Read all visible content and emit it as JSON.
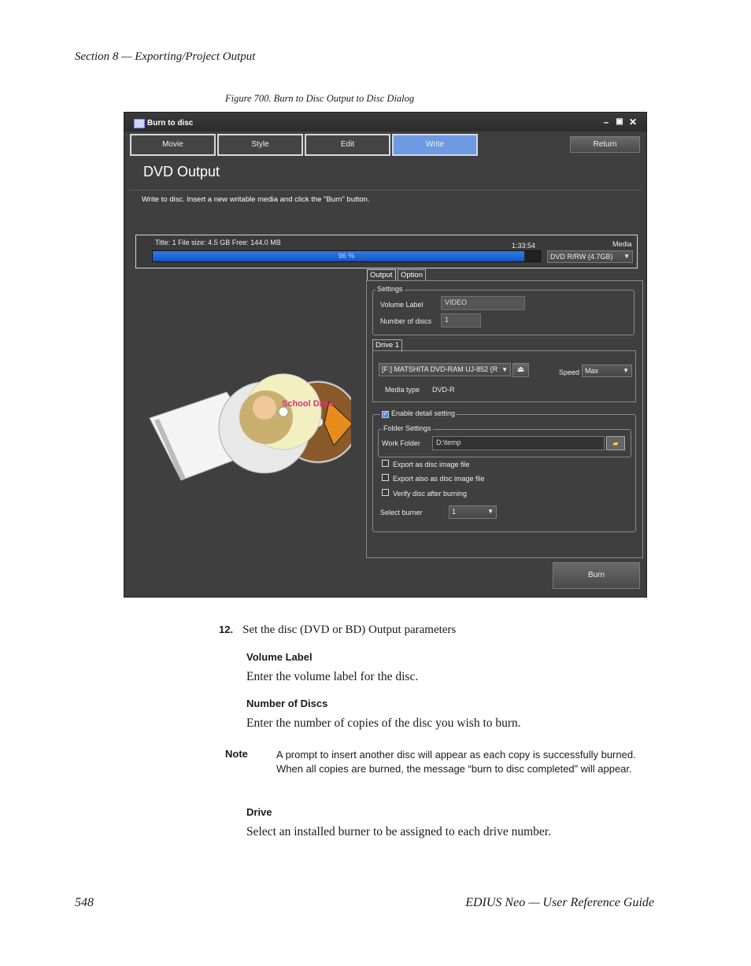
{
  "header": {
    "section": "Section 8 — Exporting/Project Output"
  },
  "figure_caption": "Figure 700.  Burn to Disc Output to Disc Dialog",
  "dialog": {
    "title": "Burn to disc",
    "tabs": [
      "Movie",
      "Style",
      "Edit",
      "Write"
    ],
    "active_tab": "Write",
    "return_label": "Return",
    "heading": "DVD Output",
    "message": "Write to disc. Insert a new writable media and click the \"Burn\" button.",
    "info": "Title: 1   File size: 4.5 GB   Free: 144.0 MB",
    "time": "1:33:54",
    "progress_label": "96 %",
    "progress": 0.96,
    "media_label": "Media",
    "media_value": "DVD R/RW (4.7GB)",
    "panel_tabs": [
      "Output",
      "Option"
    ],
    "settings_group": "Settings",
    "volume_label_label": "Volume Label",
    "volume_label_value": "VIDEO",
    "num_discs_label": "Number of discs",
    "num_discs_value": "1",
    "drive_tab": "Drive 1",
    "drive_value": "[F:] MATSHITA DVD-RAM UJ-852 (R",
    "speed_label": "Speed",
    "speed_value": "Max",
    "media_type_label": "Media type",
    "media_type_value": "DVD-R",
    "enable_detail": "Enable detail setting",
    "folder_settings": "Folder Settings",
    "work_folder_label": "Work Folder",
    "work_folder_value": "D:\\temp",
    "export_image": "Export as disc image file",
    "export_also": "Export also as disc image file",
    "verify": "Verify disc after burning",
    "select_burner_label": "Select burner",
    "select_burner_value": "1",
    "burn_label": "Burn",
    "disc_graphic_text": "School Days"
  },
  "content": {
    "step_num": "12.",
    "step_text": "Set the disc (DVD or BD) Output parameters",
    "h1": "Volume Label",
    "p1": "Enter the volume label for the disc.",
    "h2": "Number of Discs",
    "p2": "Enter the number of copies of the disc you wish to burn.",
    "note_label": "Note",
    "note_text": "A prompt to insert another disc will appear as each copy is successfully burned. When all copies are burned, the message “burn to disc completed” will appear.",
    "h3": "Drive",
    "p3": "Select an installed burner to be assigned to each drive number."
  },
  "footer": {
    "page": "548",
    "title": "EDIUS Neo  —  User Reference Guide"
  }
}
